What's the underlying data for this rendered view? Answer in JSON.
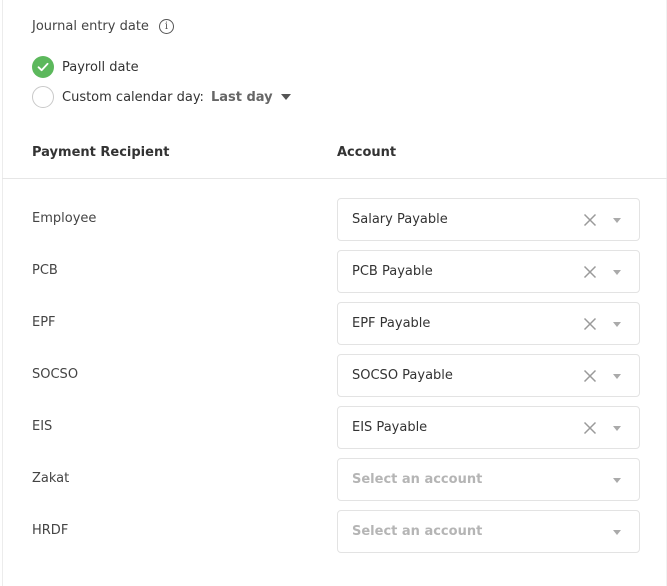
{
  "journal": {
    "label": "Journal entry date",
    "info_icon": "info-icon",
    "options": [
      {
        "label": "Payroll date",
        "checked": true
      },
      {
        "label": "Custom calendar day:",
        "checked": false,
        "dropdown_value": "Last day"
      }
    ]
  },
  "table": {
    "headers": [
      "Payment Recipient",
      "Account"
    ],
    "rows": [
      {
        "recipient": "Employee",
        "account": "Salary Payable",
        "has_value": true
      },
      {
        "recipient": "PCB",
        "account": "PCB Payable",
        "has_value": true
      },
      {
        "recipient": "EPF",
        "account": "EPF Payable",
        "has_value": true
      },
      {
        "recipient": "SOCSO",
        "account": "SOCSO Payable",
        "has_value": true
      },
      {
        "recipient": "EIS",
        "account": "EIS Payable",
        "has_value": true
      },
      {
        "recipient": "Zakat",
        "account": "Select an account",
        "has_value": false
      },
      {
        "recipient": "HRDF",
        "account": "Select an account",
        "has_value": false
      }
    ]
  },
  "colors": {
    "check_green": "#5cb85c",
    "placeholder": "#b5b5b5"
  }
}
